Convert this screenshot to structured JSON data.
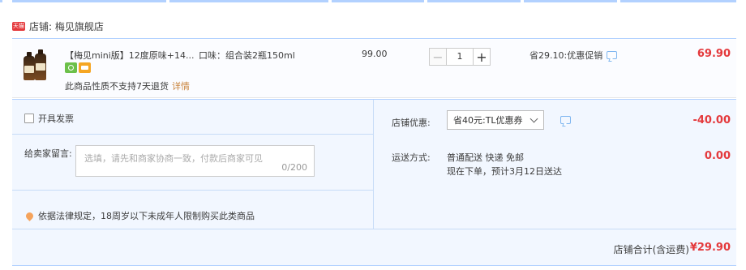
{
  "shop": {
    "badge": "天猫",
    "name": "店铺: 梅见旗舰店"
  },
  "item": {
    "title": "【梅见mini版】12度原味+14...",
    "props": "口味：组合装2瓶150ml",
    "service_icons": [
      "service-green-icon",
      "service-card-icon"
    ],
    "return_note": "此商品性质不支持7天退货",
    "return_link": "详情",
    "unit_price": "99.00",
    "quantity": "1",
    "minus": "−",
    "plus": "+",
    "promo": "省29.10:优惠促销",
    "total": "69.90"
  },
  "options": {
    "invoice_label": "开具发票",
    "message_label": "给卖家留言:",
    "message_placeholder": "选填，请先和商家协商一致，付款后商家可见",
    "message_count": "0/200",
    "legal_notice": "依据法律规定，18周岁以下未成年人限制购买此类商品"
  },
  "discount": {
    "label": "店铺优惠:",
    "selected": "省40元:TL优惠券",
    "amount": "-40.00"
  },
  "shipping": {
    "label": "运送方式:",
    "line1": "普通配送 快递 免邮",
    "line2": "现在下单，预计3月12日送达",
    "fee": "0.00"
  },
  "summary": {
    "label": "店铺合计(含运费)",
    "amount": "¥29.90"
  },
  "colors": {
    "price_red": "#e4393c",
    "border_blue": "#b2d1ff",
    "panel_bg": "#f2f7ff",
    "link_orange": "#c9833c"
  }
}
